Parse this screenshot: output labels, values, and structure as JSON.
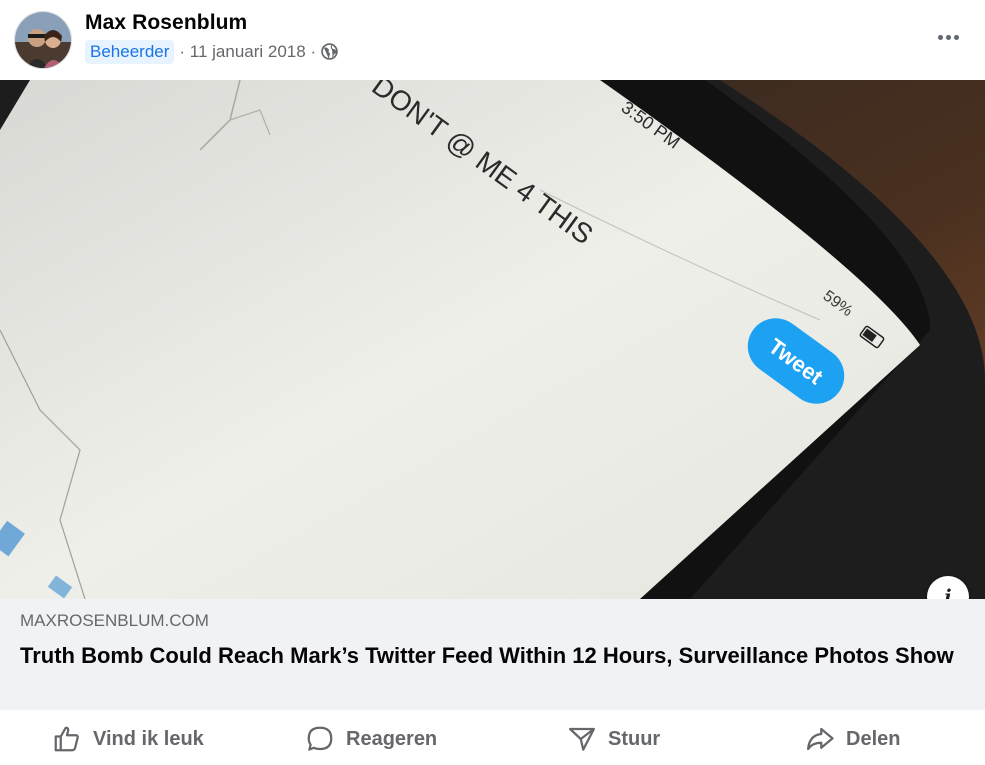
{
  "post": {
    "author": "Max Rosenblum",
    "role_badge": "Beheerder",
    "date": "· 11 januari 2018 ·",
    "more_icon": "more-dots-icon",
    "audience_icon": "globe-icon"
  },
  "photo": {
    "screen_text": "DON'T @ ME 4 THIS",
    "time": "3:50 PM",
    "battery": "59%",
    "tweet_button": "Tweet"
  },
  "link_preview": {
    "domain": "MAXROSENBLUM.COM",
    "title": "Truth Bomb Could Reach Mark’s Twitter Feed Within 12 Hours, Surveillance Photos Show",
    "info_icon": "i"
  },
  "actions": {
    "like": "Vind ik leuk",
    "comment": "Reageren",
    "send": "Stuur",
    "share": "Delen"
  },
  "colors": {
    "badge_bg": "#e7f3ff",
    "badge_text": "#1b74e4",
    "secondary_text": "#65676b",
    "tweet_blue": "#1da1f2"
  }
}
